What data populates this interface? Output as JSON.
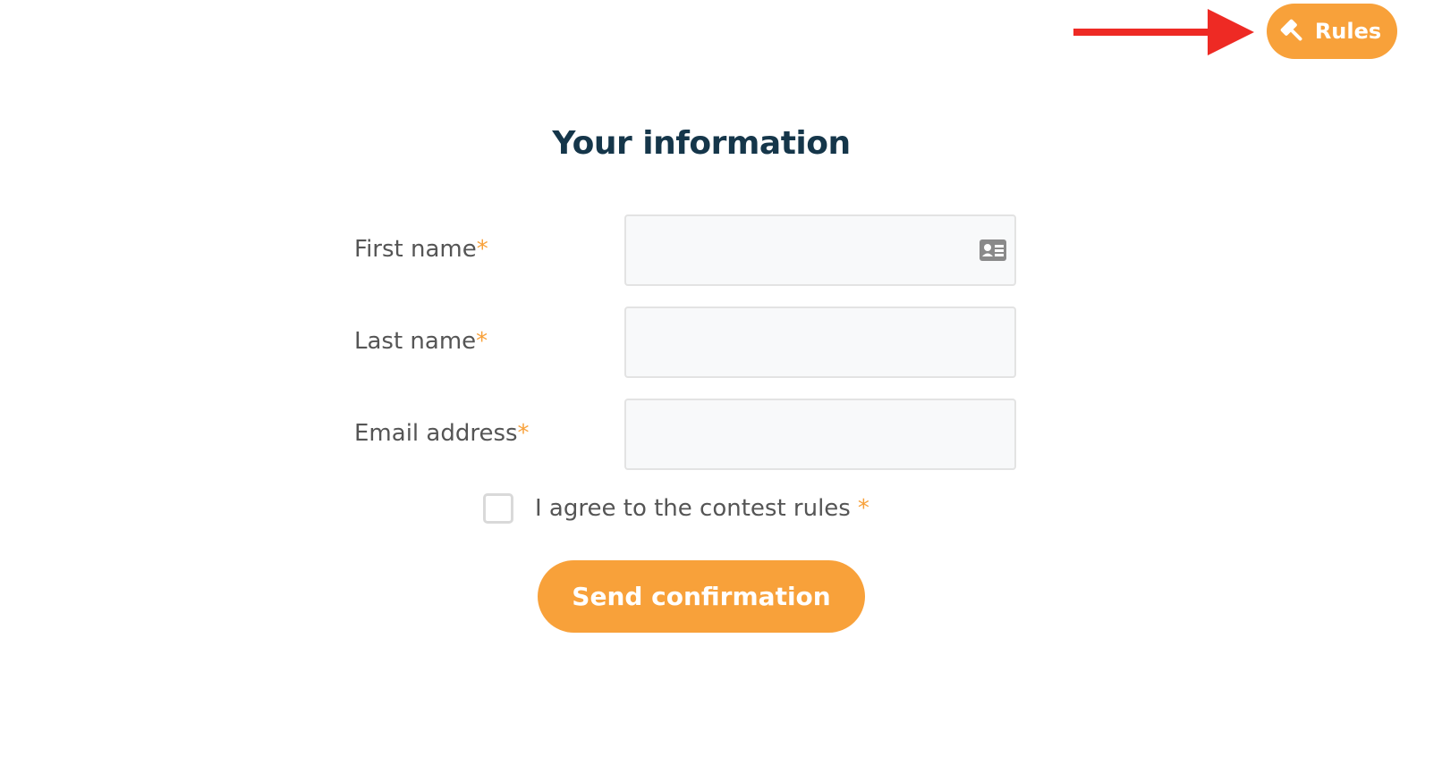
{
  "header": {
    "rules_button_label": "Rules",
    "rules_icon": "gavel-icon",
    "annotation": "red-arrow-pointing-right"
  },
  "form": {
    "title": "Your information",
    "required_marker": "*",
    "fields": [
      {
        "label": "First name",
        "value": "",
        "icon": "contact-card-icon"
      },
      {
        "label": "Last name",
        "value": ""
      },
      {
        "label": "Email address",
        "value": ""
      }
    ],
    "agree": {
      "label": "I agree to the contest rules",
      "checked": false
    },
    "submit_label": "Send confirmation"
  },
  "colors": {
    "accent": "#f8a13a",
    "title": "#15364a",
    "label": "#555555",
    "annotation_arrow": "#ee2a24",
    "field_bg": "#f8f9fa",
    "field_border": "#e3e3e3"
  }
}
